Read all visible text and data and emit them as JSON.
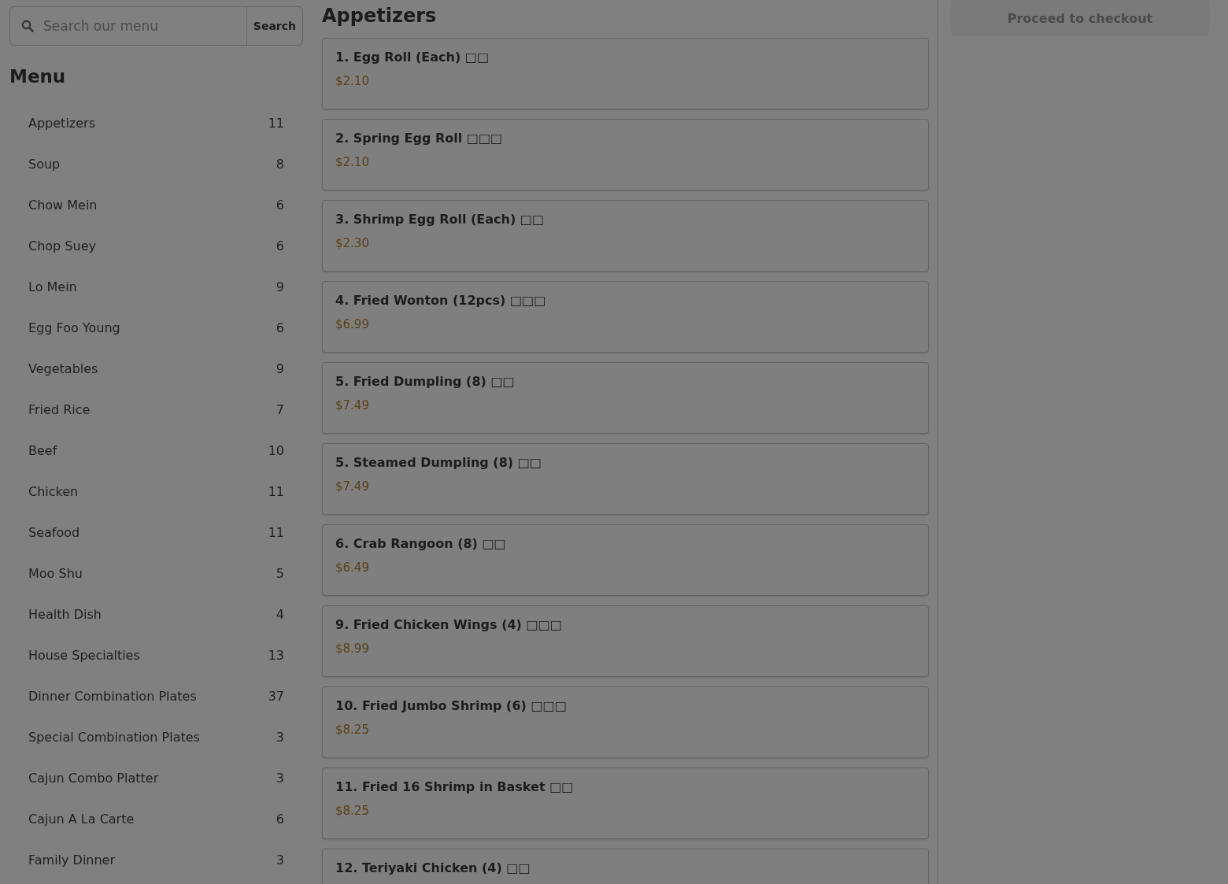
{
  "search": {
    "placeholder": "Search our menu",
    "button": "Search"
  },
  "sidebar": {
    "title": "Menu",
    "categories": [
      {
        "name": "Appetizers",
        "count": "11"
      },
      {
        "name": "Soup",
        "count": "8"
      },
      {
        "name": "Chow Mein",
        "count": "6"
      },
      {
        "name": "Chop Suey",
        "count": "6"
      },
      {
        "name": "Lo Mein",
        "count": "9"
      },
      {
        "name": "Egg Foo Young",
        "count": "6"
      },
      {
        "name": "Vegetables",
        "count": "9"
      },
      {
        "name": "Fried Rice",
        "count": "7"
      },
      {
        "name": "Beef",
        "count": "10"
      },
      {
        "name": "Chicken",
        "count": "11"
      },
      {
        "name": "Seafood",
        "count": "11"
      },
      {
        "name": "Moo Shu",
        "count": "5"
      },
      {
        "name": "Health Dish",
        "count": "4"
      },
      {
        "name": "House Specialties",
        "count": "13"
      },
      {
        "name": "Dinner Combination Plates",
        "count": "37"
      },
      {
        "name": "Special Combination Plates",
        "count": "3"
      },
      {
        "name": "Cajun Combo Platter",
        "count": "3"
      },
      {
        "name": "Cajun A La Carte",
        "count": "6"
      },
      {
        "name": "Family Dinner",
        "count": "3"
      }
    ]
  },
  "section": {
    "title": "Appetizers",
    "items": [
      {
        "name": "1. Egg Roll (Each) □□",
        "price": "$2.10"
      },
      {
        "name": "2. Spring Egg Roll □□□",
        "price": "$2.10"
      },
      {
        "name": "3. Shrimp Egg Roll (Each) □□",
        "price": "$2.30"
      },
      {
        "name": "4. Fried Wonton (12pcs) □□□",
        "price": "$6.99"
      },
      {
        "name": "5. Fried Dumpling (8) □□",
        "price": "$7.49"
      },
      {
        "name": "5. Steamed Dumpling (8) □□",
        "price": "$7.49"
      },
      {
        "name": "6. Crab Rangoon (8) □□",
        "price": "$6.49"
      },
      {
        "name": "9. Fried Chicken Wings (4) □□□",
        "price": "$8.99"
      },
      {
        "name": "10. Fried Jumbo Shrimp (6) □□□",
        "price": "$8.25"
      },
      {
        "name": "11. Fried 16 Shrimp in Basket □□",
        "price": "$8.25"
      },
      {
        "name": "12. Teriyaki Chicken (4) □□"
      }
    ]
  },
  "cart": {
    "checkout": {
      "label": "Proceed to checkout",
      "disabled": true
    }
  }
}
